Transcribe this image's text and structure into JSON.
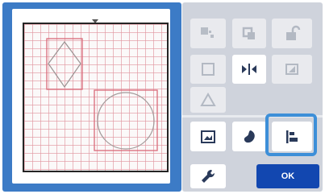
{
  "preview": {
    "shapes": [
      {
        "type": "diamond",
        "name": "diamond-shape"
      },
      {
        "type": "circle",
        "name": "circle-shape"
      }
    ]
  },
  "toolbar": {
    "row1": [
      {
        "name": "align-icon",
        "state": "disabled"
      },
      {
        "name": "duplicate-icon",
        "state": "disabled"
      },
      {
        "name": "unlock-icon",
        "state": "disabled"
      }
    ],
    "row2": [
      {
        "name": "square-icon",
        "state": "disabled"
      },
      {
        "name": "flip-horizontal-icon",
        "state": "enabled"
      },
      {
        "name": "flip-vertical-icon",
        "state": "disabled"
      }
    ],
    "row3": [
      {
        "name": "triangle-icon",
        "state": "disabled"
      }
    ],
    "row4": [
      {
        "name": "image-icon",
        "state": "enabled"
      },
      {
        "name": "shape-icon",
        "state": "enabled"
      },
      {
        "name": "layout-icon",
        "state": "selected"
      }
    ]
  },
  "footer": {
    "ok_label": "OK",
    "settings_icon": "wrench-icon"
  },
  "colors": {
    "accent": "#3c7bc6",
    "ok_button": "#1247b0",
    "highlight": "#3d8fd8",
    "shape_outline": "#d96a79",
    "panel_bg": "#cfd3dc"
  }
}
